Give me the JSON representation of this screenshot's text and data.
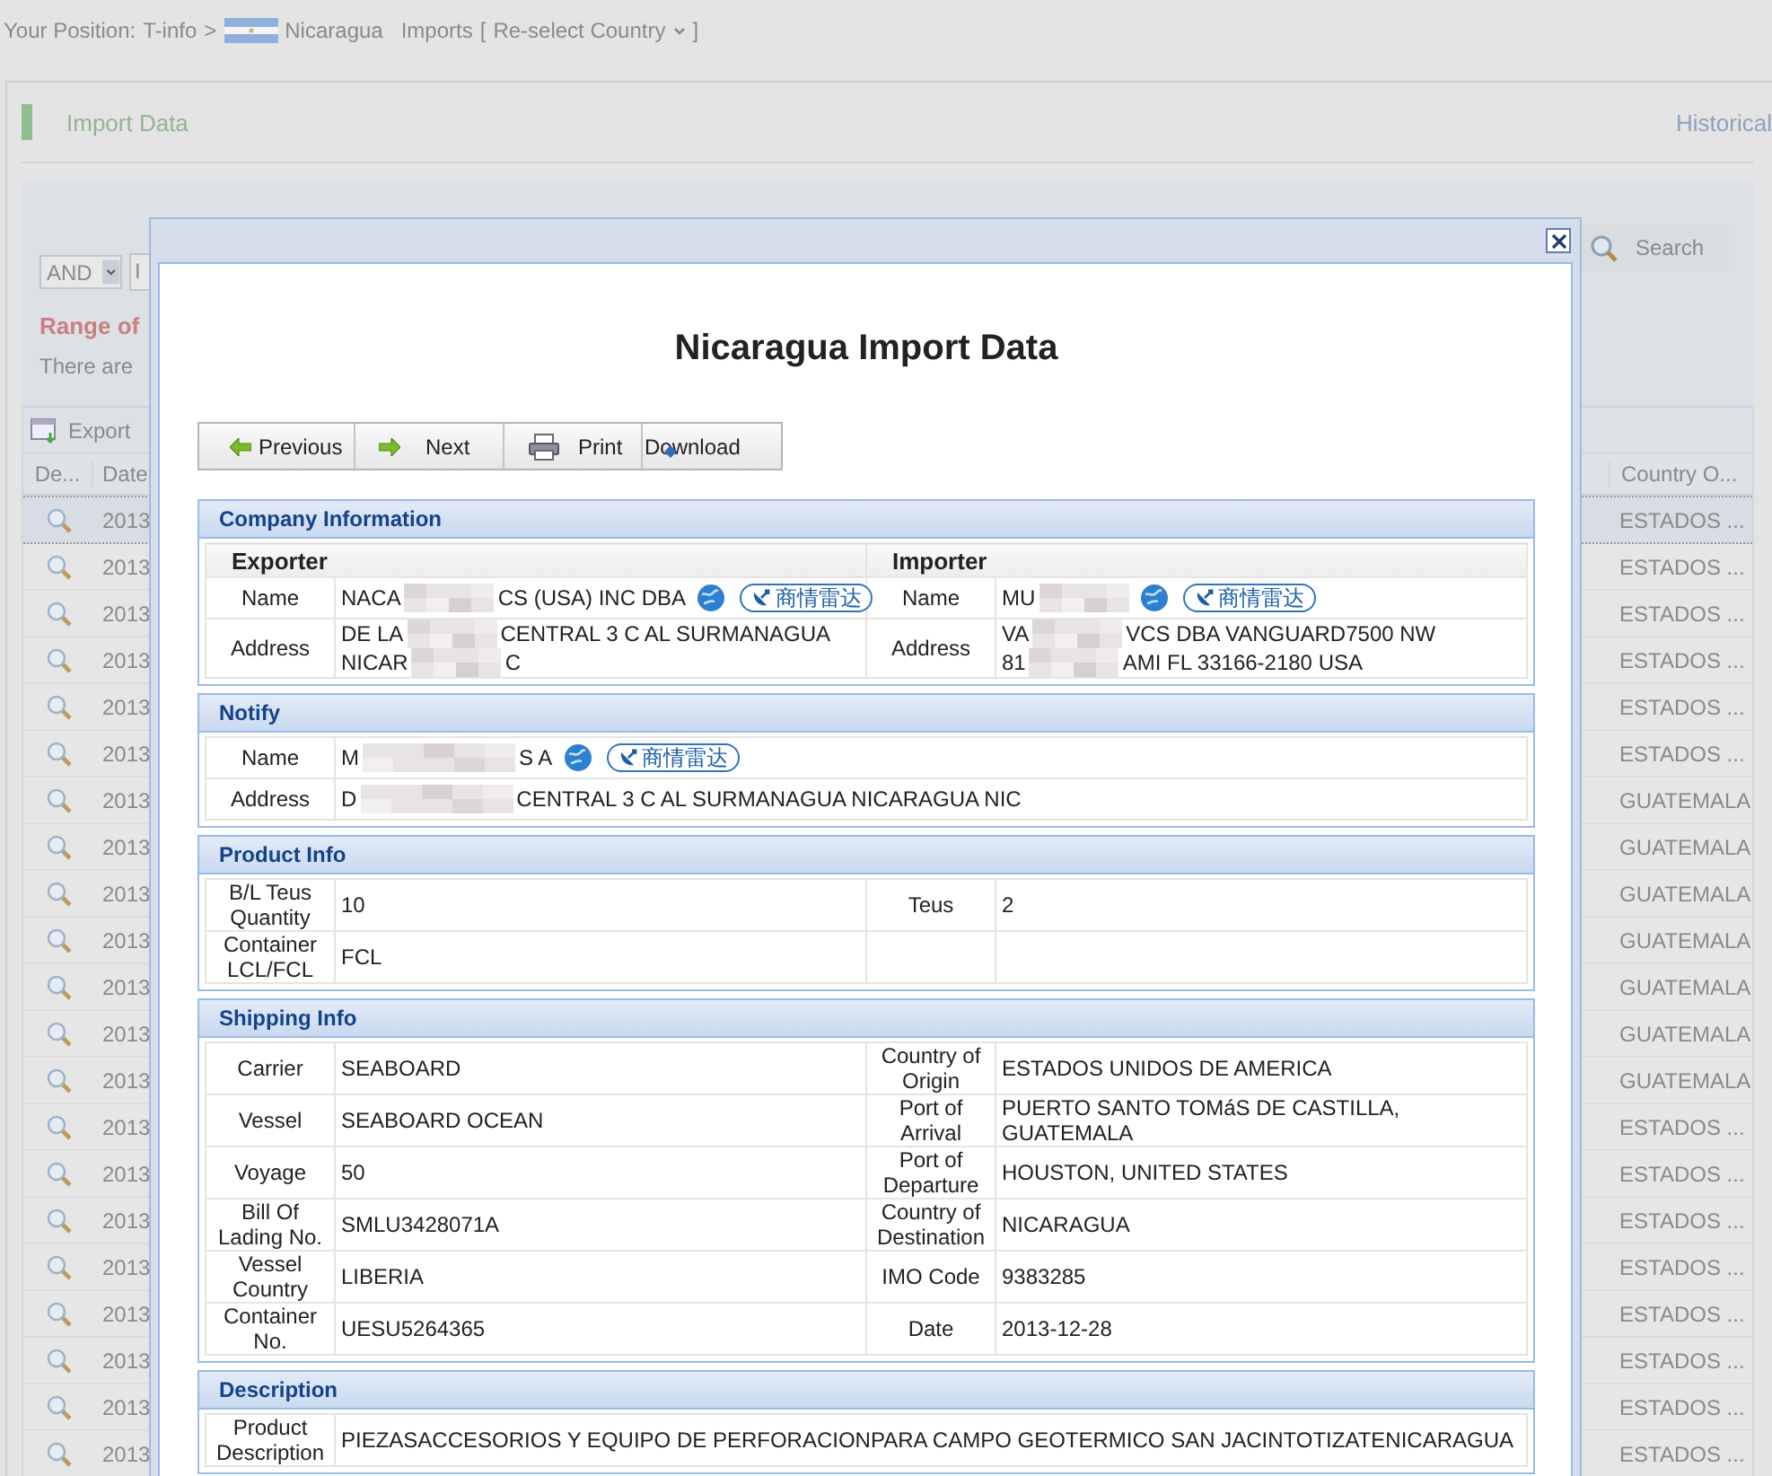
{
  "breadcrumb": {
    "prefix": "Your Position:",
    "crumb": "T-info",
    "separator": ">",
    "country": "Nicaragua",
    "section": "Imports",
    "reselect_open": "[",
    "reselect": "Re-select Country",
    "reselect_close": "]"
  },
  "panel": {
    "title": "Import Data",
    "link": "Historical"
  },
  "search": {
    "logic": "AND",
    "field_value": "I",
    "button": "Search",
    "range_label": "Range of",
    "total_text": "There are"
  },
  "grid": {
    "export_button": "Export",
    "columns": [
      "De...",
      "Date",
      "Country O..."
    ],
    "rows": [
      {
        "date": "2013",
        "country": "ESTADOS ...",
        "selected": true
      },
      {
        "date": "2013",
        "country": "ESTADOS ...",
        "selected": false
      },
      {
        "date": "2013",
        "country": "ESTADOS ...",
        "selected": false
      },
      {
        "date": "2013",
        "country": "ESTADOS ...",
        "selected": false
      },
      {
        "date": "2013",
        "country": "ESTADOS ...",
        "selected": false
      },
      {
        "date": "2013",
        "country": "ESTADOS ...",
        "selected": false
      },
      {
        "date": "2013",
        "country": "GUATEMALA",
        "selected": false
      },
      {
        "date": "2013",
        "country": "GUATEMALA",
        "selected": false
      },
      {
        "date": "2013",
        "country": "GUATEMALA",
        "selected": false
      },
      {
        "date": "2013",
        "country": "GUATEMALA",
        "selected": false
      },
      {
        "date": "2013",
        "country": "GUATEMALA",
        "selected": false
      },
      {
        "date": "2013",
        "country": "GUATEMALA",
        "selected": false
      },
      {
        "date": "2013",
        "country": "GUATEMALA",
        "selected": false
      },
      {
        "date": "2013",
        "country": "ESTADOS ...",
        "selected": false
      },
      {
        "date": "2013",
        "country": "ESTADOS ...",
        "selected": false
      },
      {
        "date": "2013",
        "country": "ESTADOS ...",
        "selected": false
      },
      {
        "date": "2013",
        "country": "ESTADOS ...",
        "selected": false
      },
      {
        "date": "2013",
        "country": "ESTADOS ...",
        "selected": false
      },
      {
        "date": "2013",
        "country": "ESTADOS ...",
        "selected": false
      },
      {
        "date": "2013",
        "country": "ESTADOS ...",
        "selected": false
      },
      {
        "date": "2013",
        "country": "ESTADOS ...",
        "selected": false
      }
    ]
  },
  "modal": {
    "title": "Nicaragua Import Data",
    "toolbar": [
      {
        "kind": "previous",
        "label": "Previous"
      },
      {
        "kind": "next",
        "label": "Next"
      },
      {
        "kind": "print",
        "label": "Print"
      },
      {
        "kind": "download",
        "label": "Download"
      }
    ],
    "sections": [
      {
        "kind": "company",
        "title": "Company Information",
        "parties": [
          {
            "heading": "Exporter",
            "fields": [
              {
                "label": "Name",
                "radar": "商情雷达",
                "lines": [
                  {
                    "before": "NACA",
                    "redacted": true,
                    "after": "CS (USA) INC DBA"
                  }
                ]
              },
              {
                "label": "Address",
                "lines": [
                  {
                    "before": "DE LA",
                    "redacted": true,
                    "after": "CENTRAL 3 C AL SURMANAGUA"
                  },
                  {
                    "before": "NICAR",
                    "redacted": true,
                    "after": "C"
                  }
                ]
              }
            ]
          },
          {
            "heading": "Importer",
            "fields": [
              {
                "label": "Name",
                "radar": "商情雷达",
                "lines": [
                  {
                    "before": "MU",
                    "redacted": true
                  }
                ]
              },
              {
                "label": "Address",
                "lines": [
                  {
                    "before": "VA",
                    "redacted": true,
                    "after": "VCS DBA VANGUARD7500 NW"
                  },
                  {
                    "before": "81",
                    "redacted": true,
                    "after": "AMI FL 33166-2180 USA"
                  }
                ]
              }
            ]
          }
        ]
      },
      {
        "kind": "party",
        "title": "Notify",
        "fields": [
          {
            "label": "Name",
            "radar": "商情雷达",
            "lines": [
              {
                "before": "M",
                "redacted": true,
                "after": "S A"
              }
            ]
          },
          {
            "label": "Address",
            "lines": [
              {
                "before": "D",
                "redacted": true,
                "after": "CENTRAL 3 C AL SURMANAGUA NICARAGUA NIC"
              }
            ]
          }
        ]
      },
      {
        "kind": "grid",
        "title": "Product Info",
        "rows": [
          [
            {
              "label": "B/L Teus Quantity",
              "value": "10"
            },
            {
              "label": "Teus",
              "value": "2"
            }
          ],
          [
            {
              "label": "Container LCL/FCL",
              "value": "FCL"
            }
          ]
        ]
      },
      {
        "kind": "grid",
        "title": "Shipping Info",
        "rows": [
          [
            {
              "label": "Carrier",
              "value": "SEABOARD"
            },
            {
              "label": "Country of Origin",
              "value": "ESTADOS UNIDOS DE AMERICA"
            }
          ],
          [
            {
              "label": "Vessel",
              "value": "SEABOARD OCEAN"
            },
            {
              "label": "Port of Arrival",
              "value": "PUERTO SANTO TOMáS DE CASTILLA, GUATEMALA"
            }
          ],
          [
            {
              "label": "Voyage",
              "value": "50"
            },
            {
              "label": "Port of Departure",
              "value": "HOUSTON, UNITED STATES"
            }
          ],
          [
            {
              "label": "Bill Of Lading No.",
              "value": "SMLU3428071A"
            },
            {
              "label": "Country of Destination",
              "value": "NICARAGUA"
            }
          ],
          [
            {
              "label": "Vessel Country",
              "value": "LIBERIA"
            },
            {
              "label": "IMO Code",
              "value": "9383285"
            }
          ],
          [
            {
              "label": "Container No.",
              "value": "UESU5264365"
            },
            {
              "label": "Date",
              "value": "2013-12-28"
            }
          ]
        ]
      },
      {
        "kind": "wide",
        "title": "Description",
        "rows": [
          {
            "label": "Product Description",
            "value": "PIEZASACCESORIOS Y EQUIPO DE PERFORACIONPARA CAMPO GEOTERMICO SAN JACINTOTIZATENICARAGUA"
          }
        ]
      }
    ]
  }
}
